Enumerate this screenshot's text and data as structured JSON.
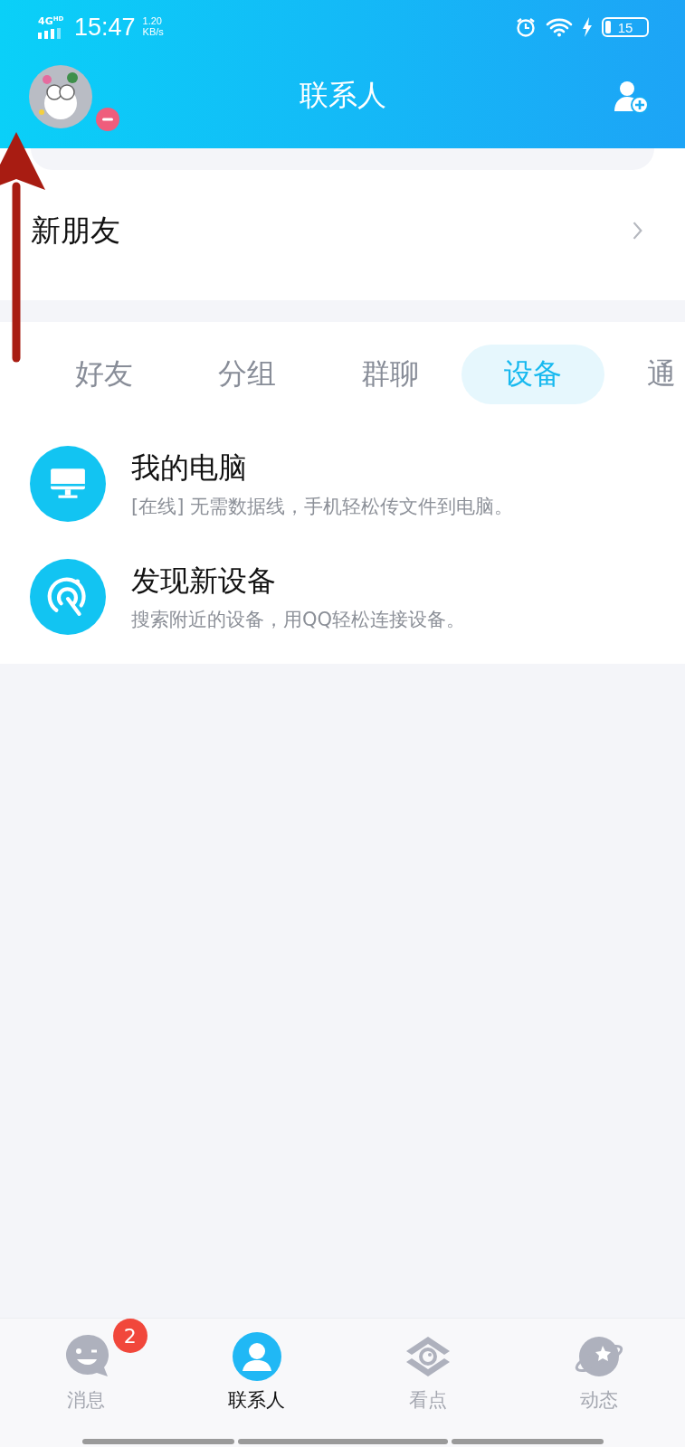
{
  "status_bar": {
    "network": "4G",
    "network_badge": "HD",
    "time": "15:47",
    "speed": "1.20",
    "speed_unit": "KB/s",
    "battery": "15"
  },
  "header": {
    "title": "联系人"
  },
  "new_friends": {
    "label": "新朋友"
  },
  "tabs": [
    {
      "label": "好友",
      "selected": false
    },
    {
      "label": "分组",
      "selected": false
    },
    {
      "label": "群聊",
      "selected": false
    },
    {
      "label": "设备",
      "selected": true
    },
    {
      "label": "通",
      "selected": false
    }
  ],
  "devices": [
    {
      "kind": "computer",
      "name": "我的电脑",
      "description": "[在线] 无需数据线，手机轻松传文件到电脑。"
    },
    {
      "kind": "discover",
      "name": "发现新设备",
      "description": "搜索附近的设备，用QQ轻松连接设备。"
    }
  ],
  "bottom_nav": [
    {
      "kind": "messages",
      "label": "消息",
      "badge": "2",
      "selected": false
    },
    {
      "kind": "contacts",
      "label": "联系人",
      "selected": true
    },
    {
      "kind": "watch",
      "label": "看点",
      "selected": false
    },
    {
      "kind": "moments",
      "label": "动态",
      "selected": false
    }
  ]
}
